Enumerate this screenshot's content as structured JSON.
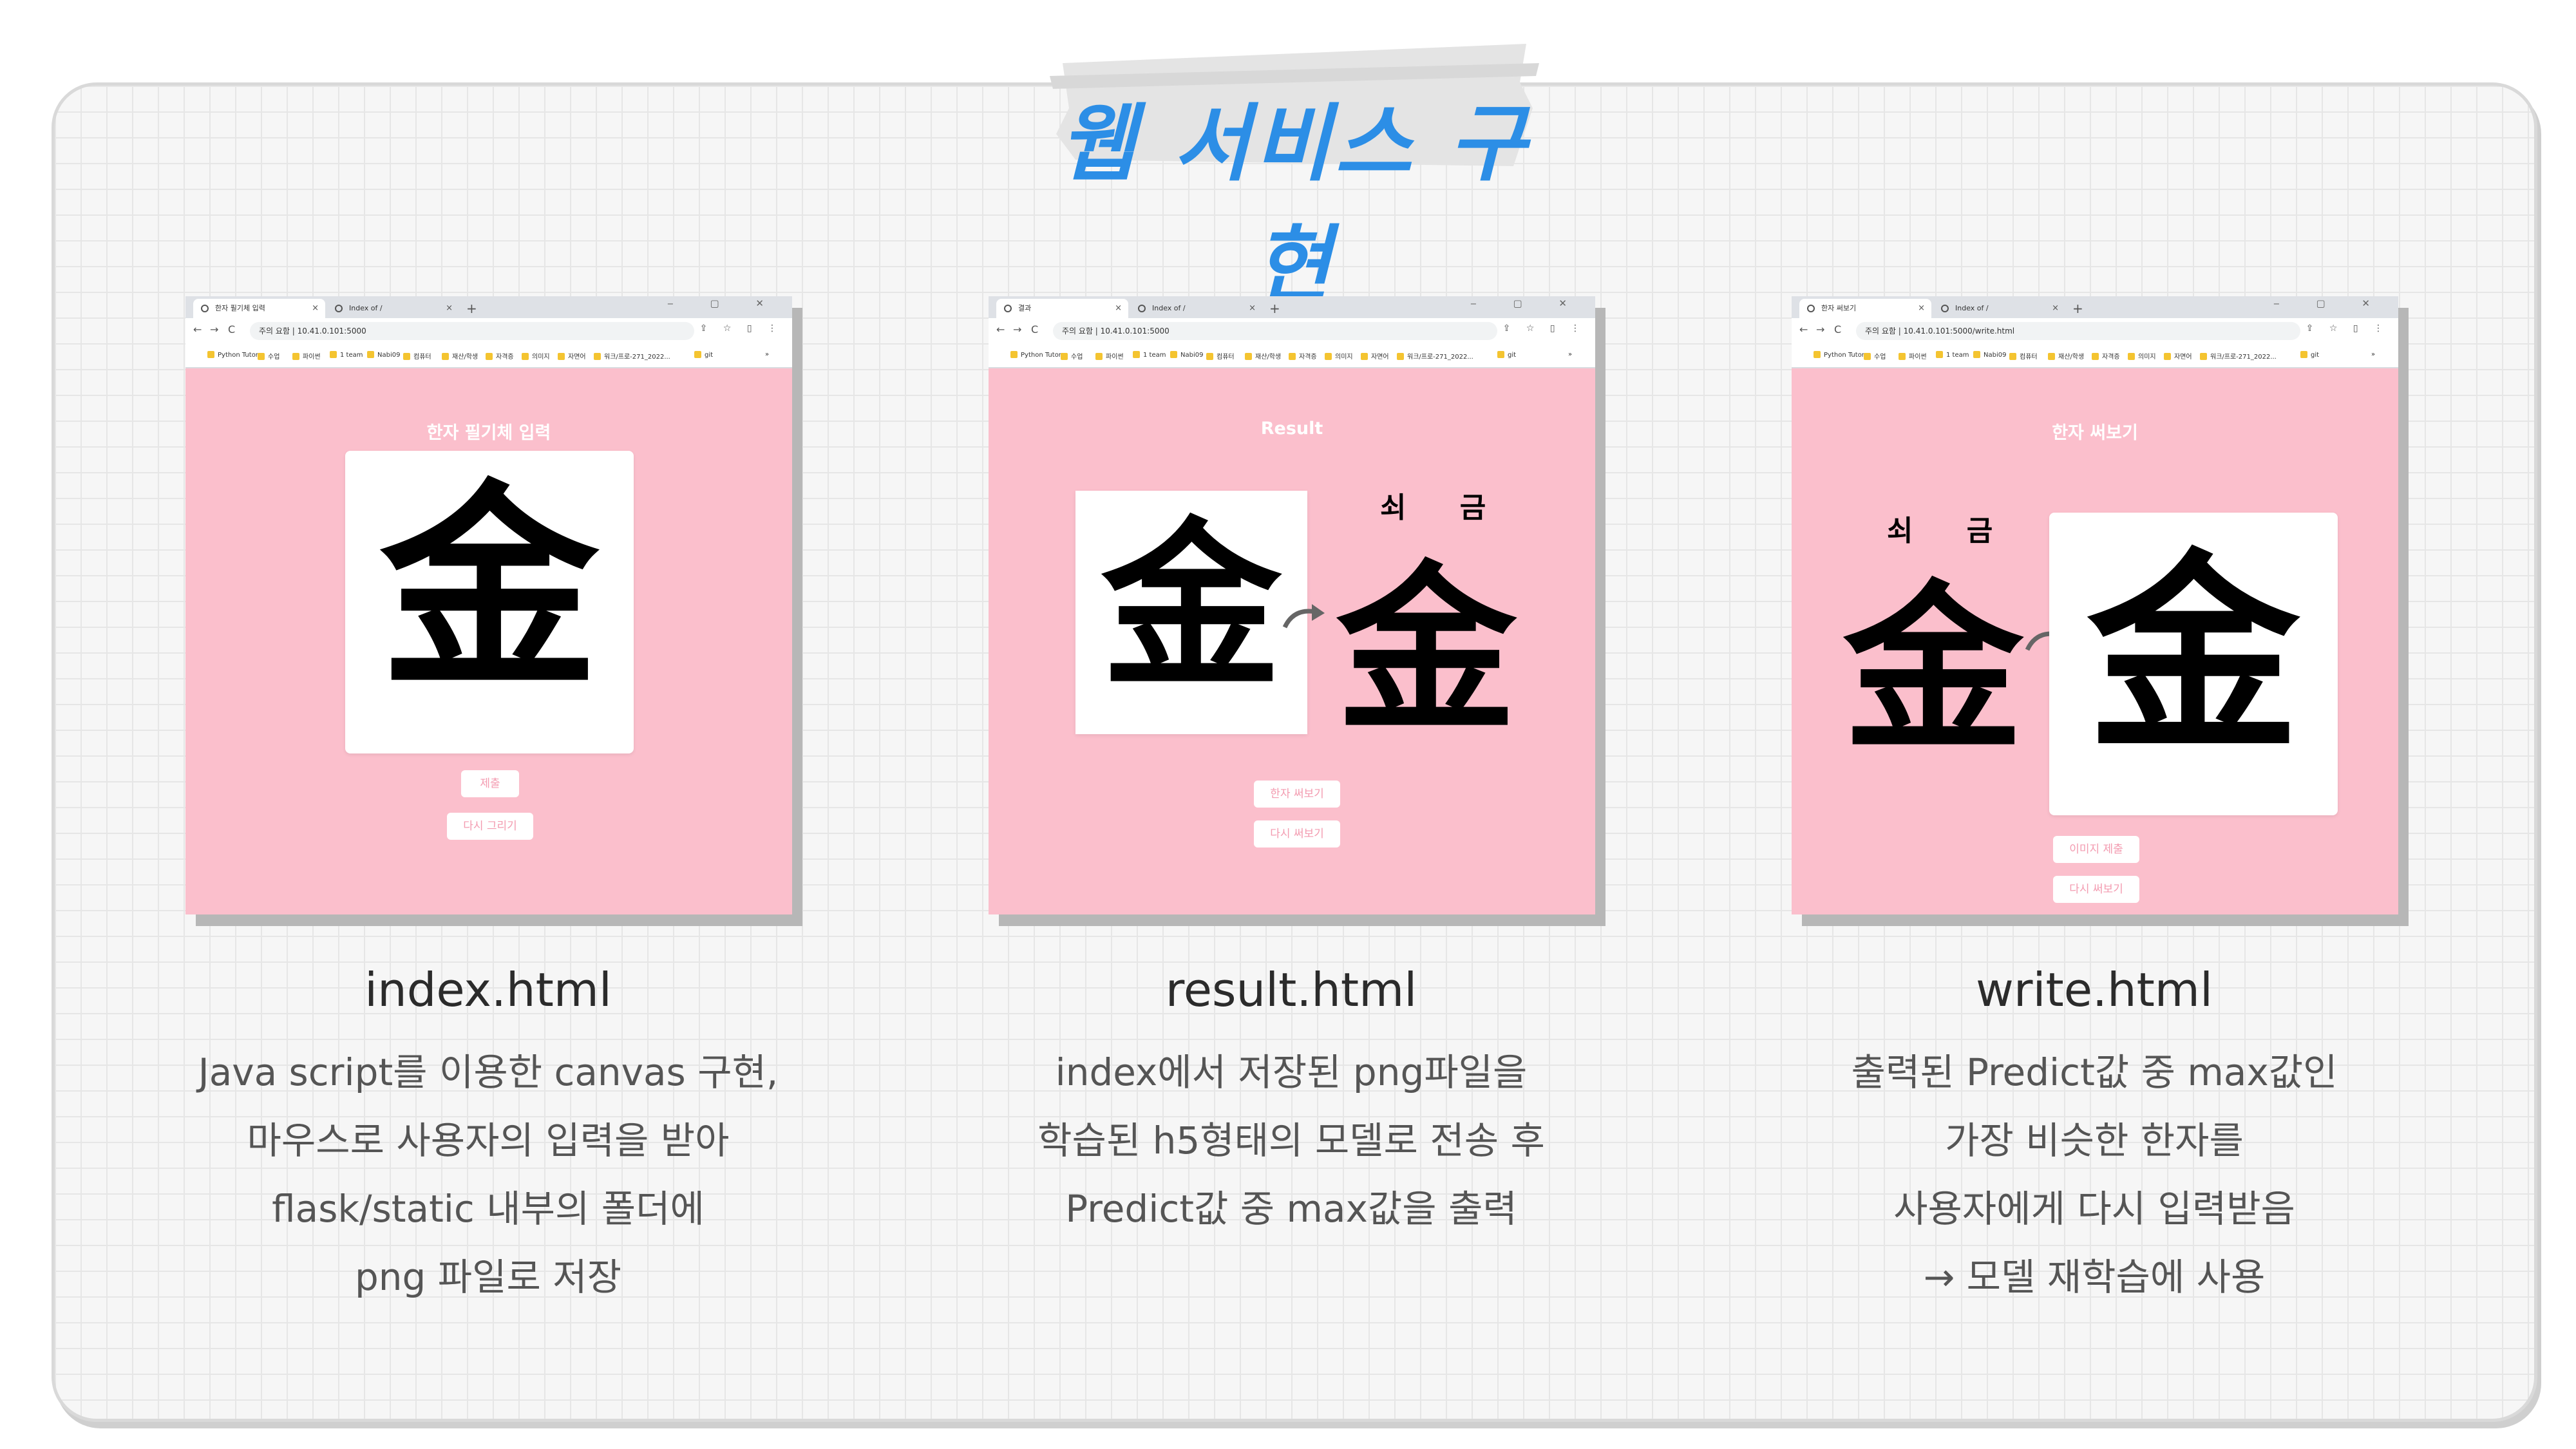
{
  "heading": "웹 서비스 구현",
  "browser": {
    "new_tab": "+",
    "window_controls": "‒ ▢ ✕",
    "nav": {
      "back": "←",
      "forward": "→",
      "reload": "C"
    },
    "addr_icons": "⇪ ☆ ▯ ⋮",
    "bookmarks": [
      "Python Tutor",
      "수업",
      "파이썬",
      "1 team",
      "Nabi09",
      "컴퓨터",
      "재산/학생",
      "자격증",
      "의미지",
      "자면어",
      "워크/프로-271_2022...",
      "git"
    ],
    "bookmarks_more": "»"
  },
  "screens": [
    {
      "tab_active": "한자 필기체 입력",
      "tab_other": "Index of /",
      "url": "주의 요함 | 10.41.0.101:5000",
      "page_title": "한자 필기체 입력",
      "hanja": "金",
      "buttons": [
        "제출",
        "다시 그리기"
      ],
      "filename": "index.html",
      "description": [
        "Java script를 이용한 canvas 구현,",
        "마우스로 사용자의 입력을 받아",
        "flask/static 내부의 폴더에",
        "png 파일로 저장"
      ]
    },
    {
      "tab_active": "결과",
      "tab_other": "Index of /",
      "url": "주의 요함 | 10.41.0.101:5000",
      "page_title": "Result",
      "hanja_input": "金",
      "reading": "쇠 금",
      "hanja_result": "金",
      "buttons": [
        "한자 써보기",
        "다시 써보기"
      ],
      "filename": "result.html",
      "description": [
        "index에서 저장된 png파일을",
        "학습된 h5형태의 모델로 전송 후",
        "Predict값 중 max값을 출력"
      ]
    },
    {
      "tab_active": "한자 써보기",
      "tab_other": "Index of /",
      "url": "주의 요함 | 10.41.0.101:5000/write.html",
      "page_title": "한자 써보기",
      "reading": "쇠 금",
      "hanja_reference": "金",
      "hanja_input": "金",
      "buttons": [
        "이미지 제출",
        "다시 써보기"
      ],
      "filename": "write.html",
      "description": [
        "출력된 Predict값 중 max값인",
        "가장 비슷한 한자를",
        "사용자에게 다시 입력받음",
        "→ 모델 재학습에 사용"
      ]
    }
  ],
  "colors": {
    "heading": "#2c8ee6",
    "page_bg": "#fbbfcc",
    "button_text": "#f39bb0",
    "text": "#555555"
  },
  "icons": {
    "arrow": "curved-arrow-icon",
    "tab": "globe-icon"
  }
}
